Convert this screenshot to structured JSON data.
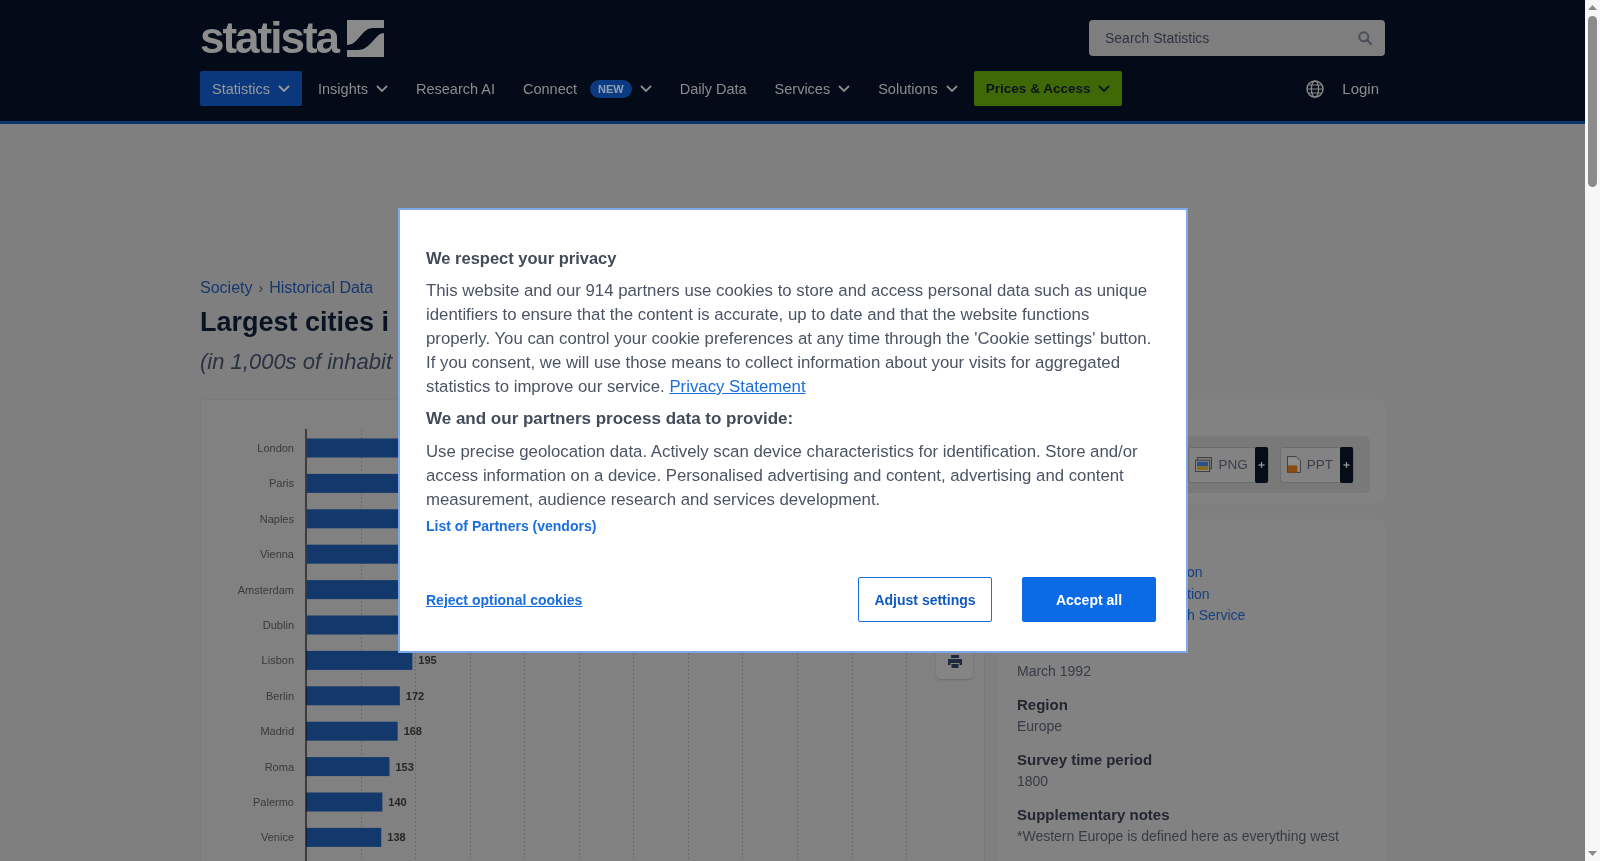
{
  "header": {
    "logo": "statista",
    "search": {
      "placeholder": "Search Statistics"
    },
    "nav": [
      {
        "label": "Statistics",
        "kind": "link",
        "dropdown": true,
        "selected": true
      },
      {
        "label": "Insights",
        "kind": "link",
        "dropdown": true,
        "selected": false
      },
      {
        "label": "Research AI",
        "kind": "link",
        "dropdown": false,
        "selected": false
      },
      {
        "label": "Connect",
        "kind": "link",
        "badge": "NEW",
        "dropdown": true,
        "selected": false
      },
      {
        "label": "Daily Data",
        "kind": "link",
        "dropdown": false,
        "selected": false
      },
      {
        "label": "Services",
        "kind": "link",
        "dropdown": true,
        "selected": false
      },
      {
        "label": "Solutions",
        "kind": "link",
        "dropdown": true,
        "selected": false
      },
      {
        "label": "Prices & Access",
        "kind": "cta",
        "dropdown": true,
        "selected": false
      }
    ],
    "login": "Login"
  },
  "breadcrumb": {
    "items": [
      "Society",
      "Historical Data"
    ],
    "separator": "›"
  },
  "title": "Largest cities i",
  "subtitle": "(in 1,000s of inhabit",
  "chart": {
    "chart_data": [
      {
        "type": "bar",
        "orientation": "horizontal",
        "categories": [
          "London",
          "Paris",
          "Naples",
          "Vienna",
          "Amsterdam",
          "Dublin",
          "Lisbon",
          "Berlin",
          "Madrid",
          "Roma",
          "Palermo",
          "Venice"
        ],
        "values": [
          null,
          null,
          null,
          null,
          null,
          null,
          195,
          172,
          168,
          153,
          140,
          138
        ],
        "color": "#13386c",
        "data_labels": true
      }
    ]
  },
  "downloads": [
    {
      "label": "PNG",
      "kind": "png"
    },
    {
      "label": "PPT",
      "kind": "ppt"
    }
  ],
  "details": {
    "links": [
      "on",
      "tion",
      "h Service"
    ],
    "fields": [
      {
        "value": "March 1992"
      },
      {
        "label": "Region",
        "value": "Europe"
      },
      {
        "label": "Survey time period",
        "value": "1800"
      },
      {
        "label": "Supplementary notes",
        "value": "*Western Europe is defined here as everything west"
      }
    ]
  },
  "consent": {
    "title": "We respect your privacy",
    "text": "This website and our 914 partners use cookies to store and access personal data such as unique identifiers to ensure that the content is accurate, up to date and that the website functions properly. You can control your cookie preferences at any time through the 'Cookie settings' button. If you consent, we will use those means to collect information about your visits for aggregated statistics to improve our service.",
    "privacy_link": "Privacy Statement",
    "purposes_title": "We and our partners process data to provide:",
    "purposes": "Use precise geolocation data. Actively scan device characteristics for identification. Store and/or access information on a device. Personalised advertising and content, advertising and content measurement, audience research and services development.",
    "partners_link": "List of Partners (vendors)",
    "reject": "Reject optional cookies",
    "buttons": [
      {
        "label": "Adjust settings",
        "kind": "secondary"
      },
      {
        "label": "Accept all",
        "kind": "primary"
      }
    ]
  }
}
